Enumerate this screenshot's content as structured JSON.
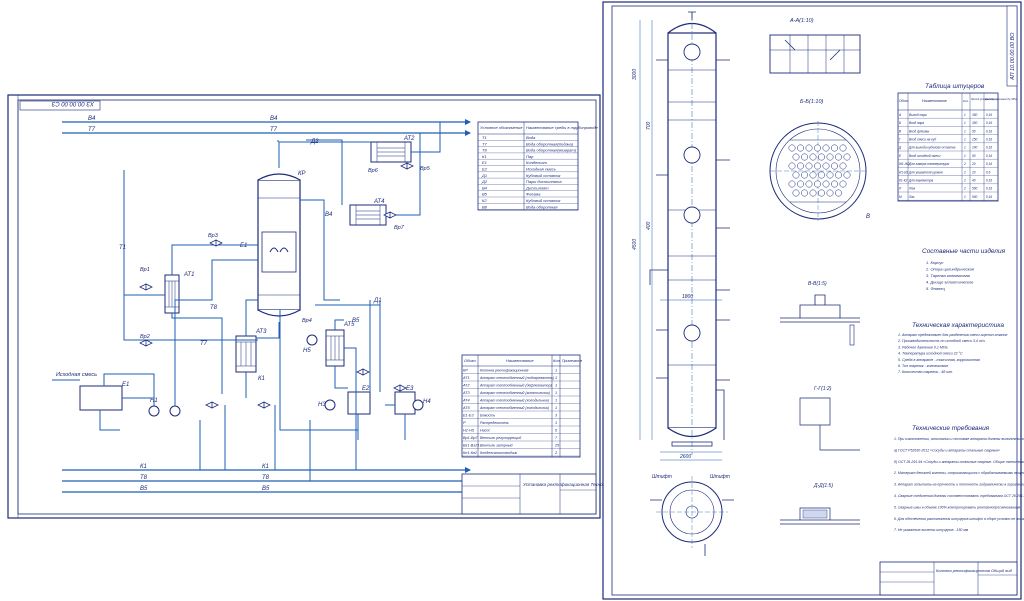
{
  "sheet1": {
    "code": "ХЗ 00.00.00 СЗ",
    "lines_top": [
      "В4",
      "Т7"
    ],
    "lines_bottom": [
      "К1",
      "Т8",
      "В5"
    ],
    "stream_labels": [
      "Д2",
      "Т1",
      "Т8",
      "Е1",
      "Д1",
      "В4",
      "В5",
      "К1",
      "Т7"
    ],
    "equipment": [
      "АТ1",
      "АТ2",
      "АТ3",
      "АТ4",
      "АТ5",
      "КР",
      "Е1",
      "Е2",
      "Е3",
      "Н1",
      "Н2",
      "Н3",
      "Н4",
      "Н5",
      "Вр1",
      "Вр2",
      "Вр3",
      "Вр4",
      "Вр5",
      "Вр6",
      "Вр7"
    ],
    "feed_label": "Исходная смесь",
    "legend": {
      "headers": [
        "Условное обозначение",
        "Наименование среды в трубопроводе"
      ],
      "rows": [
        [
          "Т1",
          "Вода"
        ],
        [
          "Т7",
          "Вода оборотная(подача)"
        ],
        [
          "Т8",
          "Вода оборотная(возврат)"
        ],
        [
          "К1",
          "Пар"
        ],
        [
          "Е1",
          "Конденсат"
        ],
        [
          "Е2",
          "Исходная смесь"
        ],
        [
          "Д1",
          "Кубовый остаток"
        ],
        [
          "Д2",
          "Пары дистиллята"
        ],
        [
          "В4",
          "Дистиллят"
        ],
        [
          "В5",
          "Флегма"
        ],
        [
          "К2",
          "Кубовый остаток"
        ],
        [
          "В8",
          "Вода оборотная"
        ]
      ]
    },
    "spec": {
      "headers": [
        "Обозн.",
        "Наименование",
        "Кол.",
        "Примечание"
      ],
      "rows": [
        [
          "КР",
          "Колонна ректификационная",
          "1",
          ""
        ],
        [
          "АТ1",
          "Аппарат теплообменный (подогреватель)",
          "1",
          ""
        ],
        [
          "АТ2",
          "Аппарат теплообменный (дефлегматор)",
          "1",
          ""
        ],
        [
          "АТ3",
          "Аппарат теплообменный (кипятильник)",
          "1",
          ""
        ],
        [
          "АТ4",
          "Аппарат теплообменный (холодильник)",
          "1",
          ""
        ],
        [
          "АТ5",
          "Аппарат теплообменный (холодильник)",
          "1",
          ""
        ],
        [
          "Е1-Е3",
          "Емкость",
          "3",
          ""
        ],
        [
          "Р",
          "Распределитель",
          "1",
          ""
        ],
        [
          "Н1-Н5",
          "Насос",
          "5",
          ""
        ],
        [
          "Вр1-Вр7",
          "Вентиль регулирующий",
          "7",
          ""
        ],
        [
          "Вз1-Вз25",
          "Вентиль запорный",
          "25",
          ""
        ],
        [
          "Кп1-Кп2",
          "Конденсатоотводчик",
          "2",
          ""
        ]
      ]
    },
    "title_block": {
      "name": "Установка ректификационная Технологическая схема"
    }
  },
  "sheet2": {
    "code": "АП 10.00.00.00 ВО",
    "view_a": "А-А(1:10)",
    "view_b": "Б-Б(1:10)",
    "view_v": "В-В(1:5)",
    "view_g": "Г-Г(1:2)",
    "view_d": "Д-Д(1:5)",
    "nozzle_table_title": "Таблица штуцеров",
    "nozzle_headers": [
      "Обозн.",
      "Наименование",
      "Кол.",
      "Проход условный Dу, мм",
      "Давление условное Ру, МПа"
    ],
    "nozzles": [
      [
        "А",
        "Выход пара",
        "1",
        "350",
        "0,16"
      ],
      [
        "Б",
        "Вход пара",
        "1",
        "300",
        "0,16"
      ],
      [
        "В",
        "Вход флегмы",
        "1",
        "50",
        "0,16"
      ],
      [
        "Г",
        "Вход смеси на куб",
        "1",
        "150",
        "0,16"
      ],
      [
        "Д",
        "Для выхода кубового остатка",
        "1",
        "100",
        "0,16"
      ],
      [
        "Е",
        "Вход исходной смеси",
        "1",
        "50",
        "0,16"
      ],
      [
        "Ж1-Ж2",
        "Для замера температуры",
        "2",
        "20",
        "0,16"
      ],
      [
        "И1-И2",
        "Для указателя уровня",
        "2",
        "20",
        "0,6"
      ],
      [
        "К1-К2",
        "Для манометра",
        "2",
        "40",
        "0,16"
      ],
      [
        "Л",
        "Люк",
        "2",
        "500",
        "0,16"
      ],
      [
        "М",
        "Лаз",
        "1",
        "500",
        "0,16"
      ]
    ],
    "parts_title": "Составные части изделия",
    "parts": [
      "1. Корпус",
      "2. Опора цилиндрическая",
      "3. Тарелка колпачковая",
      "4. Днище эллиптическое",
      "5. Фланец"
    ],
    "tech_char_title": "Техническая характеристика",
    "tech_char": [
      "1. Аппарат предназначен для разделения смеси ацетон-этанол",
      "2. Производительность по исходной смеси 3,4 т/ч",
      "3. Рабочее давление 0,1 МПа",
      "4. Температура исходной смеси 22 °С",
      "5. Среда в аппарате - токсичная, коррозионная",
      "6. Тип тарелок - колпачковые",
      "7. Количество тарелок - 48 шт."
    ],
    "tech_req_title": "Технические требования",
    "tech_req": [
      "1. При изготовлении, испытании и поставке аппарата должны выполняться требования:",
      "а) ГОСТ Р52630-2012 «Сосуды и аппараты стальные сварные»",
      "б) ОСТ 26-291-94 «Сосуды и аппараты стальные сварные. Общие технические условия»",
      "2. Материал деталей колонны, соприкасающихся с обрабатываемыми веществами - сталь 12Х18Н10Т ГОСТ 5632-2014",
      "3. Аппарат испытать на прочность и плотность гидравлически в горизонтальном положении под давлением 0,3 МПа",
      "4. Сварные соединения должны соответствовать требованиям ОСТ 26-291-94",
      "5. Сварные швы в объеме 100% контролировать рентгенопросвечиванием",
      "6. Для обеспечения расположения штуцеров штифт в сборе условно не показан",
      "7. Не указанные вылеты штуцеров - 150 мм"
    ],
    "title_block": {
      "name": "Колонна ректификационная Общий вид"
    },
    "dims": [
      "2600",
      "1800",
      "3000",
      "4500",
      "400",
      "700"
    ],
    "views_bottom": [
      "Штифт",
      "Штифт"
    ]
  }
}
